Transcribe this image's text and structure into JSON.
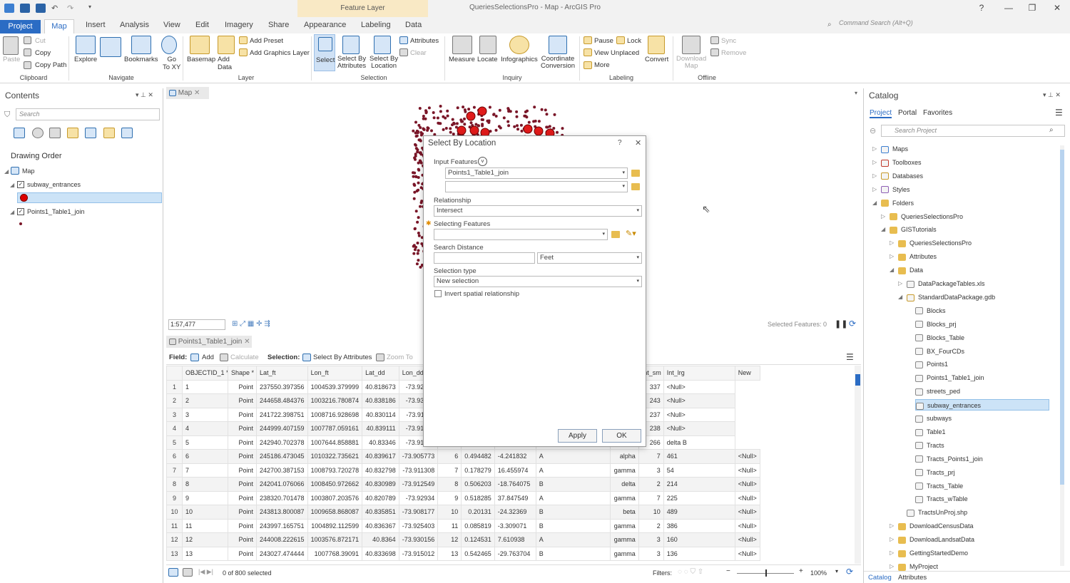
{
  "app": {
    "title": "QueriesSelectionsPro - Map - ArcGIS Pro",
    "context_band": "Feature Layer",
    "command_search_placeholder": "Command Search (Alt+Q)",
    "window_buttons": [
      "?",
      "—",
      "❐",
      "✕"
    ]
  },
  "tabs": [
    "Project",
    "Map",
    "Insert",
    "Analysis",
    "View",
    "Edit",
    "Imagery",
    "Share",
    "Appearance",
    "Labeling",
    "Data"
  ],
  "ribbon": {
    "clipboard": {
      "paste": "Paste",
      "cut": "Cut",
      "copy": "Copy",
      "copy_path": "Copy Path",
      "group": "Clipboard"
    },
    "navigate": {
      "explore": "Explore",
      "bookmarks": "Bookmarks",
      "goto": "Go\nTo XY",
      "group": "Navigate"
    },
    "layer": {
      "basemap": "Basemap",
      "add_data": "Add\nData",
      "add_preset": "Add Preset",
      "add_graphics": "Add Graphics Layer",
      "group": "Layer"
    },
    "selection": {
      "select": "Select",
      "by_attr": "Select By\nAttributes",
      "by_loc": "Select By\nLocation",
      "attributes": "Attributes",
      "clear": "Clear",
      "group": "Selection"
    },
    "inquiry": {
      "measure": "Measure",
      "locate": "Locate",
      "infographics": "Infographics",
      "coord": "Coordinate\nConversion",
      "group": "Inquiry"
    },
    "labeling": {
      "pause": "Pause",
      "lock": "Lock",
      "view_unplaced": "View Unplaced",
      "more": "More",
      "convert": "Convert",
      "group": "Labeling"
    },
    "offline": {
      "download": "Download\nMap",
      "sync": "Sync",
      "remove": "Remove",
      "group": "Offline"
    }
  },
  "contents": {
    "title": "Contents",
    "search_placeholder": "Search",
    "drawing_order": "Drawing Order",
    "map": "Map",
    "layers": [
      "subway_entrances",
      "Points1_Table1_join"
    ]
  },
  "map_view": {
    "tab": "Map",
    "scale": "1:57,477",
    "selected_features": "Selected Features: 0"
  },
  "table_view": {
    "tab": "Points1_Table1_join",
    "field_label": "Field:",
    "add": "Add",
    "calculate": "Calculate",
    "selection_label": "Selection:",
    "select_by_attr": "Select By Attributes",
    "zoom_to": "Zoom To",
    "columns": [
      "OBJECTID_1 *",
      "Shape *",
      "Lat_ft",
      "Lon_ft",
      "Lat_dd",
      "Lon_dd",
      "",
      "",
      "",
      "",
      "",
      "Int_sm",
      "Int_lrg",
      "New"
    ],
    "rows": [
      [
        "1",
        "1",
        "Point",
        "237550.397356",
        "1004539.379999",
        "40.818673",
        "-73.92669",
        "",
        "",
        "",
        "",
        "3",
        "337",
        "<Null>"
      ],
      [
        "2",
        "2",
        "Point",
        "244658.484376",
        "1003216.780874",
        "40.838186",
        "-73.93145",
        "",
        "",
        "",
        "",
        "2",
        "243",
        "<Null>"
      ],
      [
        "3",
        "3",
        "Point",
        "241722.398751",
        "1008716.928698",
        "40.830114",
        "-73.91158",
        "",
        "",
        "",
        "",
        "3",
        "237",
        "<Null>"
      ],
      [
        "4",
        "4",
        "Point",
        "244999.407159",
        "1007787.059161",
        "40.839111",
        "-73.91493",
        "",
        "",
        "",
        "",
        "5",
        "238",
        "<Null>"
      ],
      [
        "5",
        "5",
        "Point",
        "242940.702378",
        "1007644.858881",
        "40.83346",
        "-73.91545",
        "",
        "",
        "",
        "",
        "8",
        "266",
        "delta B"
      ],
      [
        "6",
        "6",
        "Point",
        "245186.473045",
        "1010322.735621",
        "40.839617",
        "-73.905773",
        "6",
        "0.494482",
        "-4.241832",
        "A",
        "alpha",
        "7",
        "461",
        "<Null>"
      ],
      [
        "7",
        "7",
        "Point",
        "242700.387153",
        "1008793.720278",
        "40.832798",
        "-73.911308",
        "7",
        "0.178279",
        "16.455974",
        "A",
        "gamma",
        "3",
        "54",
        "<Null>"
      ],
      [
        "8",
        "8",
        "Point",
        "242041.076066",
        "1008450.972662",
        "40.830989",
        "-73.912549",
        "8",
        "0.506203",
        "-18.764075",
        "B",
        "delta",
        "2",
        "214",
        "<Null>"
      ],
      [
        "9",
        "9",
        "Point",
        "238320.701478",
        "1003807.203576",
        "40.820789",
        "-73.92934",
        "9",
        "0.518285",
        "37.847549",
        "A",
        "gamma",
        "7",
        "225",
        "<Null>"
      ],
      [
        "10",
        "10",
        "Point",
        "243813.800087",
        "1009658.868087",
        "40.835851",
        "-73.908177",
        "10",
        "0.20131",
        "-24.32369",
        "B",
        "beta",
        "10",
        "489",
        "<Null>"
      ],
      [
        "11",
        "11",
        "Point",
        "243997.165751",
        "1004892.112599",
        "40.836367",
        "-73.925403",
        "11",
        "0.085819",
        "-3.309071",
        "B",
        "gamma",
        "2",
        "386",
        "<Null>"
      ],
      [
        "12",
        "12",
        "Point",
        "244008.222615",
        "1003576.872171",
        "40.8364",
        "-73.930156",
        "12",
        "0.124531",
        "7.610938",
        "A",
        "gamma",
        "3",
        "160",
        "<Null>"
      ],
      [
        "13",
        "13",
        "Point",
        "243027.474444",
        "1007768.39091",
        "40.833698",
        "-73.915012",
        "13",
        "0.542465",
        "-29.763704",
        "B",
        "gamma",
        "3",
        "136",
        "<Null>"
      ]
    ],
    "selected_count": "0 of 800 selected",
    "filters": "Filters:",
    "zoom": "100%"
  },
  "dialog": {
    "title": "Select By Location",
    "help": "?",
    "input_features_label": "Input Features",
    "input_feature_1": "Points1_Table1_join",
    "input_feature_2": "",
    "relationship_label": "Relationship",
    "relationship": "Intersect",
    "selecting_label": "Selecting Features",
    "selecting_value": "",
    "distance_label": "Search Distance",
    "distance_value": "",
    "distance_unit": "Feet",
    "selection_type_label": "Selection type",
    "selection_type": "New selection",
    "invert_label": "Invert spatial relationship",
    "apply": "Apply",
    "ok": "OK"
  },
  "catalog": {
    "title": "Catalog",
    "tabs": [
      "Project",
      "Portal",
      "Favorites"
    ],
    "search_placeholder": "Search Project",
    "items": [
      {
        "label": "Maps",
        "indent": 0,
        "icon": "map"
      },
      {
        "label": "Toolboxes",
        "indent": 0,
        "icon": "toolbox"
      },
      {
        "label": "Databases",
        "indent": 0,
        "icon": "db"
      },
      {
        "label": "Styles",
        "indent": 0,
        "icon": "style"
      },
      {
        "label": "Folders",
        "indent": 0,
        "icon": "folder"
      },
      {
        "label": "QueriesSelectionsPro",
        "indent": 1,
        "icon": "folder"
      },
      {
        "label": "GISTutorials",
        "indent": 1,
        "icon": "folder"
      },
      {
        "label": "QueriesSelectionsPro",
        "indent": 2,
        "icon": "folder"
      },
      {
        "label": "Attributes",
        "indent": 2,
        "icon": "folder"
      },
      {
        "label": "Data",
        "indent": 2,
        "icon": "folder"
      },
      {
        "label": "DataPackageTables.xls",
        "indent": 3,
        "icon": "table"
      },
      {
        "label": "StandardDataPackage.gdb",
        "indent": 3,
        "icon": "db"
      },
      {
        "label": "Blocks",
        "indent": 4,
        "icon": "fc"
      },
      {
        "label": "Blocks_prj",
        "indent": 4,
        "icon": "fc"
      },
      {
        "label": "Blocks_Table",
        "indent": 4,
        "icon": "table"
      },
      {
        "label": "BX_FourCDs",
        "indent": 4,
        "icon": "fc"
      },
      {
        "label": "Points1",
        "indent": 4,
        "icon": "fc"
      },
      {
        "label": "Points1_Table1_join",
        "indent": 4,
        "icon": "fc"
      },
      {
        "label": "streets_ped",
        "indent": 4,
        "icon": "fc"
      },
      {
        "label": "subway_entrances",
        "indent": 4,
        "icon": "fc"
      },
      {
        "label": "subways",
        "indent": 4,
        "icon": "fc"
      },
      {
        "label": "Table1",
        "indent": 4,
        "icon": "table"
      },
      {
        "label": "Tracts",
        "indent": 4,
        "icon": "fc"
      },
      {
        "label": "Tracts_Points1_join",
        "indent": 4,
        "icon": "fc"
      },
      {
        "label": "Tracts_prj",
        "indent": 4,
        "icon": "fc"
      },
      {
        "label": "Tracts_Table",
        "indent": 4,
        "icon": "table"
      },
      {
        "label": "Tracts_wTable",
        "indent": 4,
        "icon": "table"
      },
      {
        "label": "TractsUnProj.shp",
        "indent": 3,
        "icon": "fc"
      },
      {
        "label": "DownloadCensusData",
        "indent": 2,
        "icon": "folder"
      },
      {
        "label": "DownloadLandsatData",
        "indent": 2,
        "icon": "folder"
      },
      {
        "label": "GettingStartedDemo",
        "indent": 2,
        "icon": "folder"
      },
      {
        "label": "MyProject",
        "indent": 2,
        "icon": "folder"
      }
    ],
    "bottom_tabs": [
      "Catalog",
      "Attributes"
    ]
  }
}
